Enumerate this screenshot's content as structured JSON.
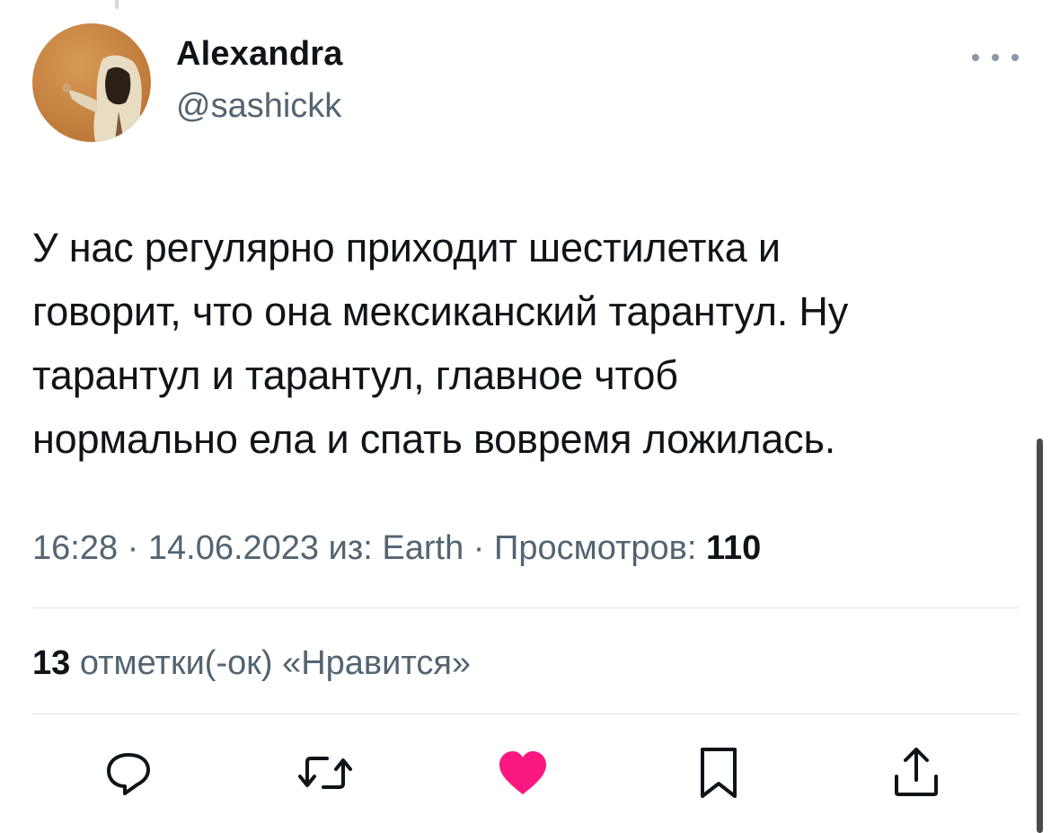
{
  "tweet": {
    "author": {
      "display_name": "Alexandra",
      "handle": "@sashickk"
    },
    "text": "У нас регулярно приходит шестилетка и\nговорит, что она мексиканский тарантул. Ну\nтарантул и тарантул, главное чтоб\nнормально ела и спать вовремя ложилась.",
    "meta": {
      "time": "16:28",
      "separator": "·",
      "date": "14.06.2023",
      "source": "из: Earth",
      "views_label": "Просмотров:",
      "views_count": "110"
    },
    "likes": {
      "count": "13",
      "label": "отметки(-ок) «Нравится»"
    },
    "actions": [
      {
        "name": "reply",
        "icon": "reply-icon"
      },
      {
        "name": "retweet",
        "icon": "retweet-icon"
      },
      {
        "name": "like",
        "icon": "heart-icon",
        "active": true
      },
      {
        "name": "bookmark",
        "icon": "bookmark-icon"
      },
      {
        "name": "share",
        "icon": "share-icon"
      }
    ]
  },
  "colors": {
    "text_primary": "#0f1419",
    "text_secondary": "#536471",
    "like_active": "#f91880",
    "divider": "#dfe3e6"
  }
}
